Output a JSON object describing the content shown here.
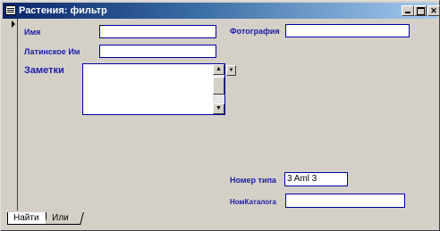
{
  "window": {
    "title": "Растения: фильтр",
    "buttons": {
      "minimize": "_",
      "maximize": "□",
      "close": "✕"
    }
  },
  "form": {
    "labels": {
      "name": "Имя",
      "latin_name": "Латинское Им",
      "notes": "Заметки",
      "photo": "Фотография",
      "type_number": "Номер типа",
      "catalog_number": "НомКаталога"
    },
    "fields": {
      "name": "",
      "latin_name": "",
      "notes": "",
      "photo": "",
      "type_number": "3 Aml 3",
      "catalog_number": ""
    }
  },
  "tabs": [
    {
      "label": "Найти",
      "active": true
    },
    {
      "label": "Или",
      "active": false
    }
  ],
  "icons": {
    "record_selector": "right-triangle-icon",
    "memo_dropdown": "down-arrow-icon",
    "scroll_up": "scroll-up-icon",
    "scroll_down": "scroll-down-icon"
  }
}
